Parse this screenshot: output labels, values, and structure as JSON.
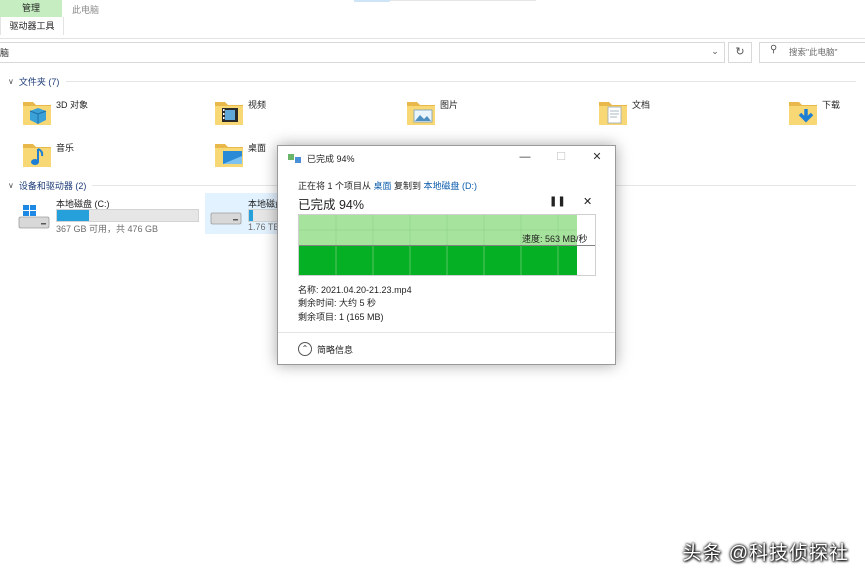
{
  "ribbon": {
    "manage_tab": "管理",
    "tools_tab": "驱动器工具",
    "title_tab": "此电脑"
  },
  "address": {
    "text": "脑",
    "search_placeholder": "搜索\"此电脑\""
  },
  "folders_group": {
    "title": "文件夹 (7)",
    "items": [
      {
        "label": "3D 对象",
        "icon": "3d-objects-folder-icon"
      },
      {
        "label": "视频",
        "icon": "videos-folder-icon"
      },
      {
        "label": "图片",
        "icon": "pictures-folder-icon"
      },
      {
        "label": "文档",
        "icon": "documents-folder-icon"
      },
      {
        "label": "下载",
        "icon": "downloads-folder-icon"
      },
      {
        "label": "音乐",
        "icon": "music-folder-icon"
      },
      {
        "label": "桌面",
        "icon": "desktop-folder-icon"
      }
    ]
  },
  "drives_group": {
    "title": "设备和驱动器 (2)",
    "drives": [
      {
        "name": "本地磁盘 (C:)",
        "size": "367 GB 可用，共 476 GB",
        "used_fraction": 0.23
      },
      {
        "name": "本地磁盘",
        "size": "1.76 TB",
        "used_fraction": 0.03
      }
    ]
  },
  "dialog": {
    "title": "已完成 94%",
    "sub_prefix": "正在将 1 个项目从 ",
    "sub_from": "桌面",
    "sub_mid": " 复制到 ",
    "sub_to": "本地磁盘 (D:)",
    "headline": "已完成 94%",
    "progress_fraction": 0.94,
    "speed": "速度: 563 MB/秒",
    "name_line": "名称: 2021.04.20-21.23.mp4",
    "time_line": "剩余时间: 大约 5 秒",
    "items_line": "剩余项目: 1 (165 MB)",
    "less_details": "简略信息"
  },
  "watermark": "头条 @科技侦探社",
  "colors": {
    "accent": "#26a0da",
    "progress_green": "#06b025",
    "progress_light": "#a6e39c",
    "link": "#0b5cad"
  }
}
